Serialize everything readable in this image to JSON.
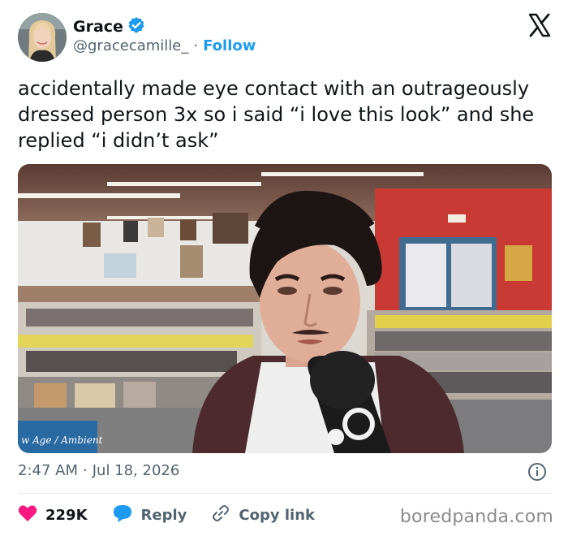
{
  "author": {
    "display_name": "Grace",
    "handle": "@gracecamille_",
    "separator": "·",
    "follow_label": "Follow",
    "verified": true
  },
  "tweet": {
    "text": "accidentally made eye contact with an outrageously dressed person 3x so i said “i love this look” and she replied “i didn’t ask”",
    "image_sign_text": "w Age / Ambient"
  },
  "meta": {
    "time": "2:47 AM",
    "separator": "·",
    "date": "Jul 18, 2026"
  },
  "actions": {
    "likes_count": "229K",
    "reply_label": "Reply",
    "copy_link_label": "Copy link"
  },
  "watermark": "boredpanda.com",
  "colors": {
    "accent": "#1d9bf0",
    "like": "#f91880",
    "secondary_text": "#536471"
  }
}
